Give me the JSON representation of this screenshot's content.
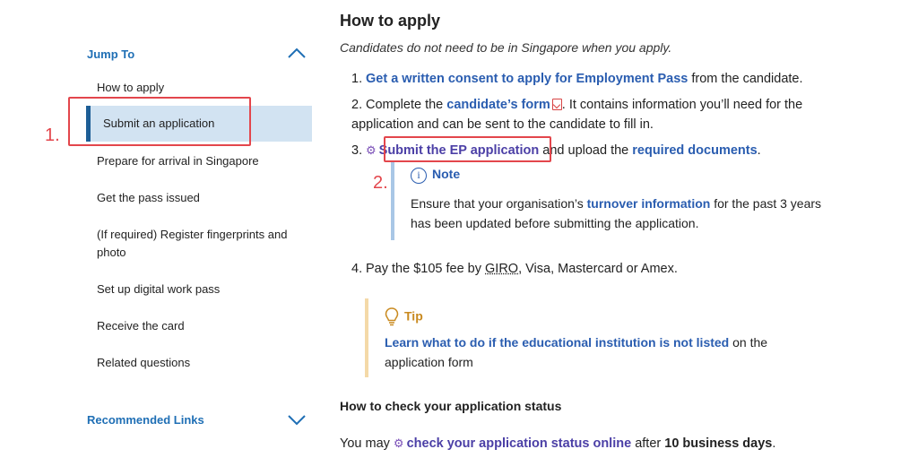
{
  "sidebar": {
    "jump_to_label": "Jump To",
    "items": [
      {
        "label": "How to apply"
      },
      {
        "label": "Submit an application"
      },
      {
        "label": "Prepare for arrival in Singapore"
      },
      {
        "label": "Get the pass issued"
      },
      {
        "label": "(If required) Register fingerprints and photo"
      },
      {
        "label": "Set up digital work pass"
      },
      {
        "label": "Receive the card"
      },
      {
        "label": "Related questions"
      }
    ],
    "recommended_label": "Recommended Links"
  },
  "annotations": {
    "label_1": "1.",
    "label_2": "2."
  },
  "main": {
    "title": "How to apply",
    "intro": "Candidates do not need to be in Singapore when you apply.",
    "steps": {
      "s1_num": "1.",
      "s1_link": "Get a written consent to apply for Employment Pass",
      "s1_rest": " from the candidate.",
      "s2_num": "2.",
      "s2_pre": "Complete the ",
      "s2_link": "candidate’s form",
      "s2_rest": ". It contains information you’ll need for the application and can be sent to the candidate to fill in.",
      "s3_num": "3.",
      "s3_link": "Submit the EP application",
      "s3_mid": " and upload the ",
      "s3_link2": "required documents",
      "s3_end": ".",
      "s4_num": "4.",
      "s4_pre": "Pay the $105 fee by ",
      "s4_abbr": "GIRO",
      "s4_rest": ", Visa, Mastercard or Amex."
    },
    "note": {
      "title": "Note",
      "body_pre": "Ensure that your organisation’s ",
      "body_link": "turnover information",
      "body_rest": " for the past 3 years has been updated before submitting the application."
    },
    "tip": {
      "title": "Tip",
      "body_link": "Learn what to do if the educational institution is not listed",
      "body_rest": " on the application form"
    },
    "status": {
      "heading": "How to check your application status",
      "pre": "You may ",
      "link": "check your application status online",
      "mid": " after ",
      "bold": "10 business days",
      "end": "."
    }
  },
  "colors": {
    "link": "#2a5db0",
    "sidebar_active_bg": "#d2e3f2",
    "sidebar_active_bar": "#1d5e96",
    "annotation_red": "#e3464c",
    "tip_accent": "#c98a20"
  }
}
